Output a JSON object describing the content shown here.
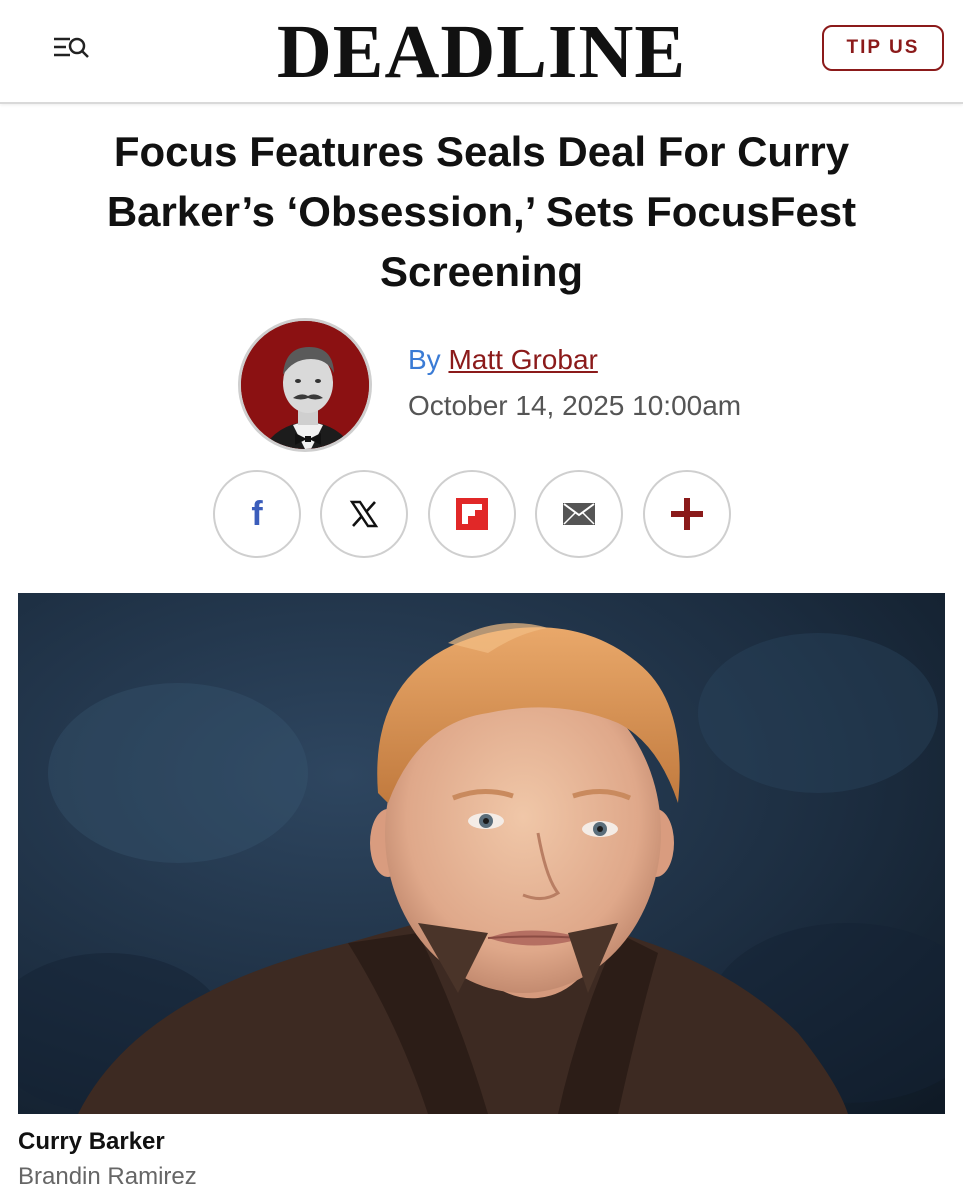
{
  "header": {
    "logo": "DEADLINE",
    "tip_label": "TIP US"
  },
  "article": {
    "headline": "Focus Features Seals Deal For Curry Barker’s ‘Obsession,’ Sets FocusFest Screening",
    "byline_prefix": "By",
    "author": "Matt Grobar",
    "date": "October 14, 2025 10:00am"
  },
  "share": {
    "icons": [
      "facebook-icon",
      "x-icon",
      "flipboard-icon",
      "email-icon",
      "plus-icon"
    ],
    "facebook_glyph": "f",
    "plus_color": "#8b1a1a",
    "facebook_color": "#3b5dbb",
    "flipboard_color": "#e12828"
  },
  "photo": {
    "caption": "Curry Barker",
    "credit": "Brandin Ramirez"
  },
  "colors": {
    "brand_red": "#8b1a1a",
    "link_blue": "#3a7bd5"
  }
}
